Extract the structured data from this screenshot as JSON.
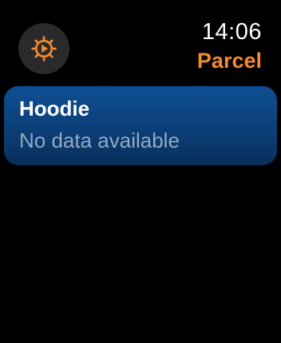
{
  "status": {
    "time": "14:06",
    "app_title": "Parcel"
  },
  "settings": {
    "icon": "gear-play-icon",
    "accent_color": "#f28a2e"
  },
  "parcels": [
    {
      "name": "Hoodie",
      "status": "No data available"
    }
  ]
}
